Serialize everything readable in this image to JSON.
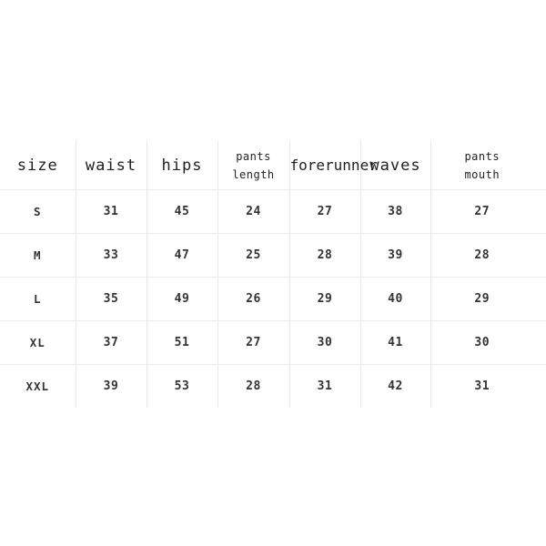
{
  "chart_data": {
    "type": "table",
    "title": "",
    "columns": [
      {
        "key": "size",
        "label": "size",
        "lines": [
          "size"
        ],
        "style": "single"
      },
      {
        "key": "waist",
        "label": "waist",
        "lines": [
          "waist"
        ],
        "style": "single"
      },
      {
        "key": "hips",
        "label": "hips",
        "lines": [
          "hips"
        ],
        "style": "single"
      },
      {
        "key": "pants_length",
        "label": "pants length",
        "lines": [
          "pants",
          "length"
        ],
        "style": "two-line"
      },
      {
        "key": "forerunner",
        "label": "forerunner",
        "lines": [
          "forerunner"
        ],
        "style": "tight"
      },
      {
        "key": "waves",
        "label": "waves",
        "lines": [
          "waves"
        ],
        "style": "single"
      },
      {
        "key": "pants_mouth",
        "label": "pants mouth",
        "lines": [
          "pants",
          "mouth"
        ],
        "style": "two-line"
      }
    ],
    "categories": [
      "S",
      "M",
      "L",
      "XL",
      "XXL"
    ],
    "rows": [
      {
        "size": "S",
        "waist": "31",
        "hips": "45",
        "pants_length": "24",
        "forerunner": "27",
        "waves": "38",
        "pants_mouth": "27"
      },
      {
        "size": "M",
        "waist": "33",
        "hips": "47",
        "pants_length": "25",
        "forerunner": "28",
        "waves": "39",
        "pants_mouth": "28"
      },
      {
        "size": "L",
        "waist": "35",
        "hips": "49",
        "pants_length": "26",
        "forerunner": "29",
        "waves": "40",
        "pants_mouth": "29"
      },
      {
        "size": "XL",
        "waist": "37",
        "hips": "51",
        "pants_length": "27",
        "forerunner": "30",
        "waves": "41",
        "pants_mouth": "30"
      },
      {
        "size": "XXL",
        "waist": "39",
        "hips": "53",
        "pants_length": "28",
        "forerunner": "31",
        "waves": "42",
        "pants_mouth": "31"
      }
    ],
    "series": [
      {
        "name": "waist",
        "values": [
          31,
          33,
          35,
          37,
          39
        ]
      },
      {
        "name": "hips",
        "values": [
          45,
          47,
          49,
          51,
          53
        ]
      },
      {
        "name": "pants length",
        "values": [
          24,
          25,
          26,
          27,
          28
        ]
      },
      {
        "name": "forerunner",
        "values": [
          27,
          28,
          29,
          30,
          31
        ]
      },
      {
        "name": "waves",
        "values": [
          38,
          39,
          40,
          41,
          42
        ]
      },
      {
        "name": "pants mouth",
        "values": [
          27,
          28,
          29,
          30,
          31
        ]
      }
    ],
    "xlabel": "",
    "ylabel": "",
    "grid": true,
    "legend": "none"
  },
  "style": {
    "background": "#ffffff",
    "text_color": "#2b2b2b",
    "header_color": "#1f1f1f",
    "grid_color": "#e9e9e9"
  }
}
